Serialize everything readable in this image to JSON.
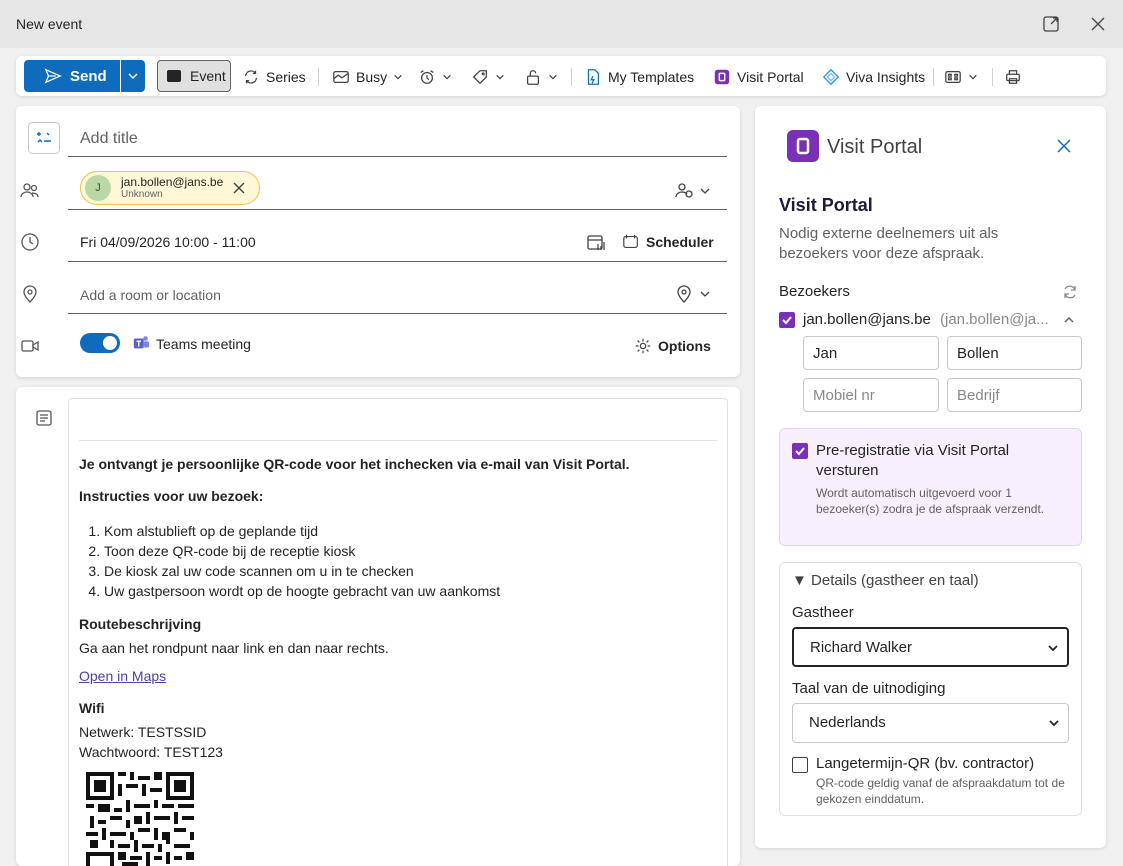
{
  "window": {
    "title": "New event"
  },
  "toolbar": {
    "send": "Send",
    "event": "Event",
    "series": "Series",
    "busy": "Busy",
    "my_templates": "My Templates",
    "visit_portal": "Visit Portal",
    "viva_insights": "Viva Insights"
  },
  "form": {
    "title_placeholder": "Add title",
    "attendee_email": "jan.bollen@jans.be",
    "attendee_status": "Unknown",
    "attendee_initial": "J",
    "datetime": "Fri 04/09/2026 10:00 - 11:00",
    "scheduler": "Scheduler",
    "location_placeholder": "Add a room or location",
    "teams_meeting": "Teams meeting",
    "options": "Options"
  },
  "body": {
    "intro": "Je ontvangt je persoonlijke QR-code voor het inchecken via e-mail van Visit Portal.",
    "instructions_heading": "Instructies voor uw bezoek:",
    "steps": [
      "Kom alstublieft op de geplande tijd",
      "Toon deze QR-code bij de receptie kiosk",
      "De kiosk zal uw code scannen om u in te checken",
      "Uw gastpersoon wordt op de hoogte gebracht van uw aankomst"
    ],
    "route_heading": "Routebeschrijving",
    "route_text": "Ga aan het rondpunt naar link en dan naar rechts.",
    "maps_link": "Open in Maps",
    "wifi_heading": "Wifi",
    "wifi_network": "Netwerk: TESTSSID",
    "wifi_password": "Wachtwoord: TEST123"
  },
  "panel": {
    "app_name": "Visit Portal",
    "heading": "Visit Portal",
    "description": "Nodig externe deelnemers uit als bezoekers voor deze afspraak.",
    "visitors_label": "Bezoekers",
    "visitor_email": "jan.bollen@jans.be",
    "visitor_email_secondary": "(jan.bollen@ja...",
    "first_name": "Jan",
    "last_name": "Bollen",
    "mobile_placeholder": "Mobiel nr",
    "company_placeholder": "Bedrijf",
    "prereg_label": "Pre-registratie via Visit Portal versturen",
    "prereg_note": "Wordt automatisch uitgevoerd voor 1 bezoeker(s) zodra je de afspraak verzendt.",
    "details_label": "▼ Details (gastheer en taal)",
    "host_label": "Gastheer",
    "host_value": "Richard Walker",
    "language_label": "Taal van de uitnodiging",
    "language_value": "Nederlands",
    "longterm_label": "Langetermijn-QR (bv. contractor)",
    "longterm_note": "QR-code geldig vanaf de afspraakdatum tot de gekozen einddatum."
  },
  "colors": {
    "accent": "#0f6cbd",
    "purple": "#7a2fb5",
    "chip_bg": "#fff7d6"
  }
}
